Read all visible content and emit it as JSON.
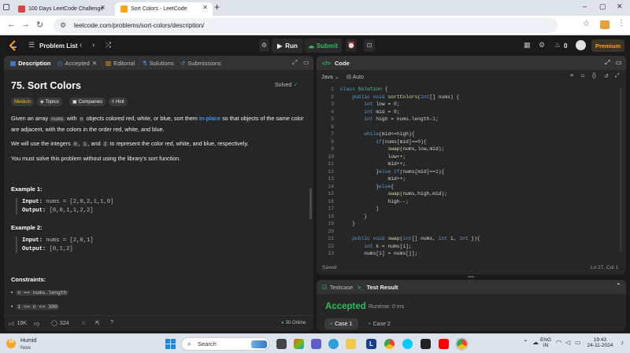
{
  "browser": {
    "tabs": [
      {
        "title": "100 Days LeetCode Challenge",
        "active": false
      },
      {
        "title": "Sort Colors - LeetCode",
        "active": true
      }
    ],
    "url": "leetcode.com/problems/sort-colors/description/"
  },
  "nav": {
    "problem_list": "Problem List",
    "run": "Run",
    "submit": "Submit",
    "coins": "0",
    "premium": "Premium"
  },
  "left_tabs": [
    "Description",
    "Accepted",
    "Editorial",
    "Solutions",
    "Submissions"
  ],
  "problem": {
    "title": "75. Sort Colors",
    "status": "Solved",
    "difficulty": "Medium",
    "tags": [
      "Topics",
      "Companies",
      "Hint"
    ],
    "desc": {
      "a": "Given an array",
      "nums": "nums",
      "b": "with",
      "n": "n",
      "c": "objects colored red, white, or blue, sort them",
      "inplace": "in-place",
      "d": "so that objects of the same",
      "e": "color are adjacent, with the colors in the order red, white, and blue."
    },
    "p2": {
      "a": "We will use the integers",
      "z": "0",
      "o": "1",
      "and": ", and",
      "t": "2",
      "b": "to represent the color red, white, and blue, respectively."
    },
    "p3": "You must solve this problem without using the library's sort function.",
    "examples": [
      {
        "heading": "Example 1:",
        "input_label": "Input:",
        "input": "nums = [2,0,2,1,1,0]",
        "output_label": "Output:",
        "output": "[0,0,1,1,2,2]"
      },
      {
        "heading": "Example 2:",
        "input_label": "Input:",
        "input": "nums = [2,0,1]",
        "output_label": "Output:",
        "output": "[0,1,2]"
      }
    ],
    "constraints_heading": "Constraints:",
    "constraints": [
      "n == nums.length",
      "1 <= n <= 300"
    ]
  },
  "footer": {
    "likes": "19K",
    "comments": "324",
    "online": "30 Online"
  },
  "code_panel": {
    "title": "Code",
    "language": "Java",
    "mode": "Auto",
    "status": "Saved",
    "cursor": "Ln 27, Col 1",
    "lines": [
      {
        "n": "1",
        "t": "class Solution {"
      },
      {
        "n": "2",
        "t": "    public void sortColors(int[] nums) {"
      },
      {
        "n": "3",
        "t": "        int low = 0;"
      },
      {
        "n": "4",
        "t": "        int mid = 0;"
      },
      {
        "n": "5",
        "t": "        int high = nums.length-1;"
      },
      {
        "n": "6",
        "t": ""
      },
      {
        "n": "7",
        "t": "        while(mid<=high){"
      },
      {
        "n": "8",
        "t": "            if(nums[mid]==0){"
      },
      {
        "n": "9",
        "t": "                swap(nums,low,mid);"
      },
      {
        "n": "10",
        "t": "                low++;"
      },
      {
        "n": "11",
        "t": "                mid++;"
      },
      {
        "n": "12",
        "t": "            }else if(nums[mid]==1){"
      },
      {
        "n": "13",
        "t": "                mid++;"
      },
      {
        "n": "14",
        "t": "            }else{"
      },
      {
        "n": "15",
        "t": "                swap(nums,high,mid);"
      },
      {
        "n": "16",
        "t": "                high--;"
      },
      {
        "n": "17",
        "t": "            }"
      },
      {
        "n": "18",
        "t": "        }"
      },
      {
        "n": "19",
        "t": "    }"
      },
      {
        "n": "20",
        "t": ""
      },
      {
        "n": "21",
        "t": "    public void swap(int[] nums, int i, int j){"
      },
      {
        "n": "22",
        "t": "        int k = nums[i];"
      },
      {
        "n": "23",
        "t": "        nums[i] = nums[j];"
      }
    ]
  },
  "test_panel": {
    "tabs": [
      "Testcase",
      "Test Result"
    ],
    "result": "Accepted",
    "runtime": "Runtime: 0 ms",
    "cases": [
      "Case 1",
      "Case 2"
    ]
  },
  "taskbar": {
    "weather_temp": "18",
    "weather": "Humid",
    "weather_sub": "Now",
    "search": "Search",
    "lang": "ENG",
    "region": "IN",
    "time": "19:43",
    "date": "24-11-2024"
  },
  "colors": {
    "accent": "#ffa116",
    "green": "#2cbb5d",
    "link": "#3b93f5",
    "bg": "#1a1a1a",
    "panel": "#262626"
  }
}
